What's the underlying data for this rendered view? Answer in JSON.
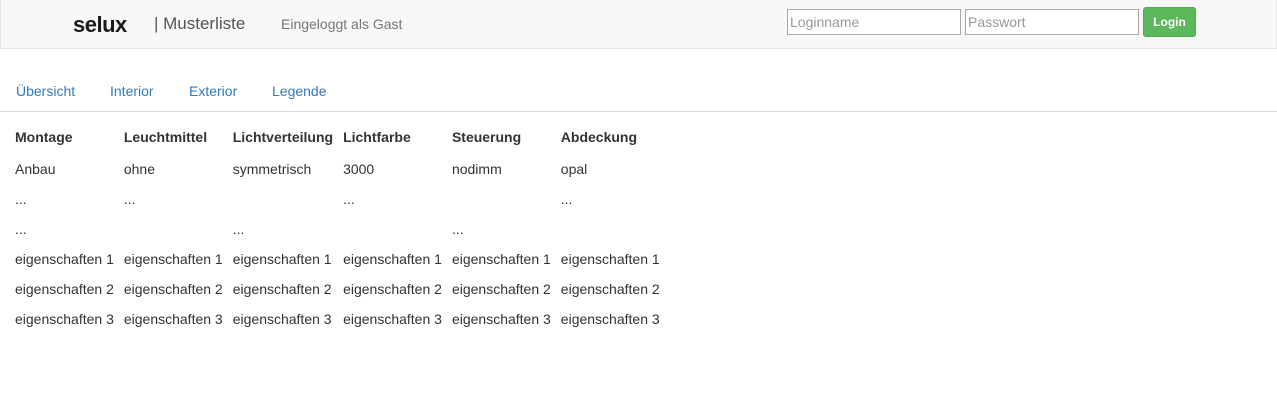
{
  "header": {
    "brand": "selux",
    "subtitle": "| Musterliste",
    "logged_in_text": "Eingeloggt als Gast",
    "login_placeholder": "Loginname",
    "password_placeholder": "Passwort",
    "login_button": "Login"
  },
  "tabs": [
    {
      "label": "Übersicht"
    },
    {
      "label": "Interior"
    },
    {
      "label": "Exterior"
    },
    {
      "label": "Legende"
    }
  ],
  "table": {
    "headers": [
      "Montage",
      "Leuchtmittel",
      "Lichtverteilung",
      "Lichtfarbe",
      "Steuerung",
      "Abdeckung"
    ],
    "rows": [
      [
        "Anbau",
        "ohne",
        "symmetrisch",
        "3000",
        "nodimm",
        "opal"
      ],
      [
        "...",
        "...",
        "",
        "...",
        "",
        "..."
      ],
      [
        "...",
        "",
        "...",
        "",
        "...",
        ""
      ],
      [
        "eigenschaften 1",
        "eigenschaften 1",
        "eigenschaften 1",
        "eigenschaften 1",
        "eigenschaften 1",
        "eigenschaften 1"
      ],
      [
        "eigenschaften 2",
        "eigenschaften 2",
        "eigenschaften 2",
        "eigenschaften 2",
        "eigenschaften 2",
        "eigenschaften 2"
      ],
      [
        "eigenschaften 3",
        "eigenschaften 3",
        "eigenschaften 3",
        "eigenschaften 3",
        "eigenschaften 3",
        "eigenschaften 3"
      ]
    ]
  },
  "colors": {
    "navbar_bg": "#f8f8f8",
    "link": "#337ab7",
    "login_button": "#5cb85c"
  }
}
